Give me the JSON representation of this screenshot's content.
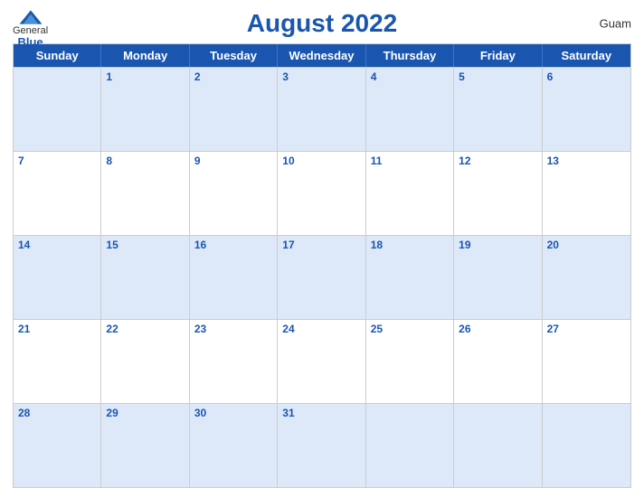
{
  "header": {
    "title": "August 2022",
    "region": "Guam",
    "logo": {
      "general": "General",
      "blue": "Blue"
    }
  },
  "weekdays": [
    "Sunday",
    "Monday",
    "Tuesday",
    "Wednesday",
    "Thursday",
    "Friday",
    "Saturday"
  ],
  "weeks": [
    [
      "",
      "1",
      "2",
      "3",
      "4",
      "5",
      "6"
    ],
    [
      "7",
      "8",
      "9",
      "10",
      "11",
      "12",
      "13"
    ],
    [
      "14",
      "15",
      "16",
      "17",
      "18",
      "19",
      "20"
    ],
    [
      "21",
      "22",
      "23",
      "24",
      "25",
      "26",
      "27"
    ],
    [
      "28",
      "29",
      "30",
      "31",
      "",
      "",
      ""
    ]
  ]
}
